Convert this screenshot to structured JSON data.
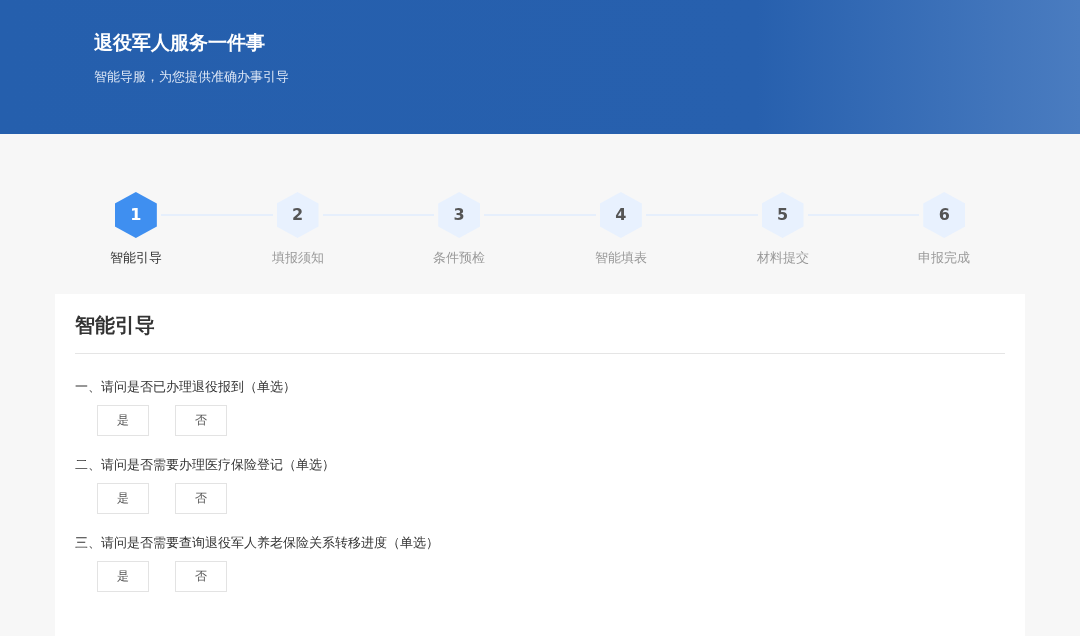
{
  "header": {
    "title": "退役军人服务一件事",
    "subtitle": "智能导服，为您提供准确办事引导"
  },
  "steps": [
    {
      "number": "1",
      "label": "智能引导",
      "selected": true
    },
    {
      "number": "2",
      "label": "填报须知",
      "selected": false
    },
    {
      "number": "3",
      "label": "条件预检",
      "selected": false
    },
    {
      "number": "4",
      "label": "智能填表",
      "selected": false
    },
    {
      "number": "5",
      "label": "材料提交",
      "selected": false
    },
    {
      "number": "6",
      "label": "申报完成",
      "selected": false
    }
  ],
  "panel": {
    "title": "智能引导",
    "questions": [
      {
        "text": "一、请问是否已办理退役报到（单选）",
        "options": [
          {
            "label": "是",
            "selected": false
          },
          {
            "label": "否",
            "selected": false
          }
        ]
      },
      {
        "text": "二、请问是否需要办理医疗保险登记（单选）",
        "options": [
          {
            "label": "是",
            "selected": false
          },
          {
            "label": "否",
            "selected": false
          }
        ]
      },
      {
        "text": "三、请问是否需要查询退役军人养老保险关系转移进度（单选）",
        "options": [
          {
            "label": "是",
            "selected": false
          },
          {
            "label": "否",
            "selected": false
          }
        ]
      }
    ]
  }
}
